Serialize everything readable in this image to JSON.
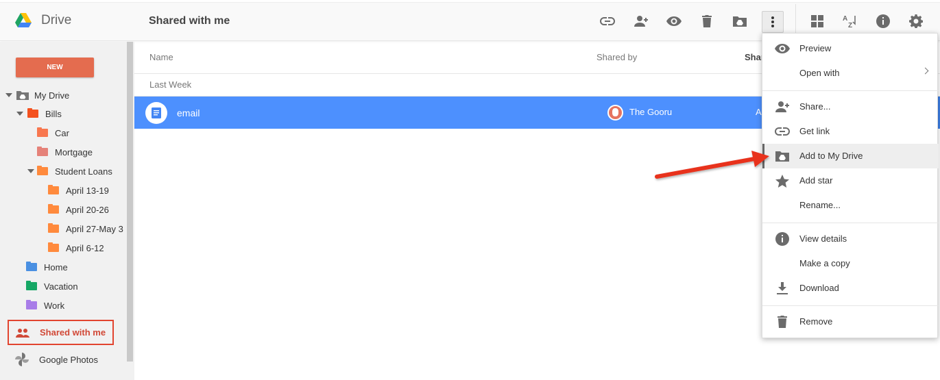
{
  "header": {
    "brand": "Drive",
    "title": "Shared with me"
  },
  "toolbar": {
    "icons": [
      "link-icon",
      "add-person-icon",
      "eye-icon",
      "trash-icon",
      "add-to-drive-icon",
      "more-vert-icon",
      "grid-view-icon",
      "sort-az-icon",
      "info-icon",
      "settings-icon"
    ]
  },
  "sidebar": {
    "new_label": "NEW",
    "my_drive": "My Drive",
    "bills": "Bills",
    "car": "Car",
    "mortgage": "Mortgage",
    "student_loans": "Student Loans",
    "april_13_19": "April 13-19",
    "april_20_26": "April 20-26",
    "april_27_may3": "April 27-May 3",
    "april_6_12": "April 6-12",
    "home": "Home",
    "vacation": "Vacation",
    "work": "Work",
    "shared_with_me": "Shared with me",
    "google_photos": "Google Photos"
  },
  "colors": {
    "bills": "#f4511e",
    "car": "#f8774f",
    "mortgage": "#e58279",
    "student_loans": "#ff8a3d",
    "subfolders": "#ff8a3d",
    "home": "#4a90e2",
    "vacation": "#16a765",
    "work": "#a87de8",
    "selection": "#4d90fe",
    "accent_red": "#d14836"
  },
  "list": {
    "col_name": "Name",
    "col_shared_by": "Shared by",
    "col_third": "Shar",
    "section": "Last Week",
    "file_name": "email",
    "shared_by": "The Gooru",
    "third_value": "A"
  },
  "menu": {
    "preview": "Preview",
    "open_with": "Open with",
    "share": "Share...",
    "get_link": "Get link",
    "add_to_drive": "Add to My Drive",
    "add_star": "Add star",
    "rename": "Rename...",
    "view_details": "View details",
    "make_copy": "Make a copy",
    "download": "Download",
    "remove": "Remove"
  }
}
